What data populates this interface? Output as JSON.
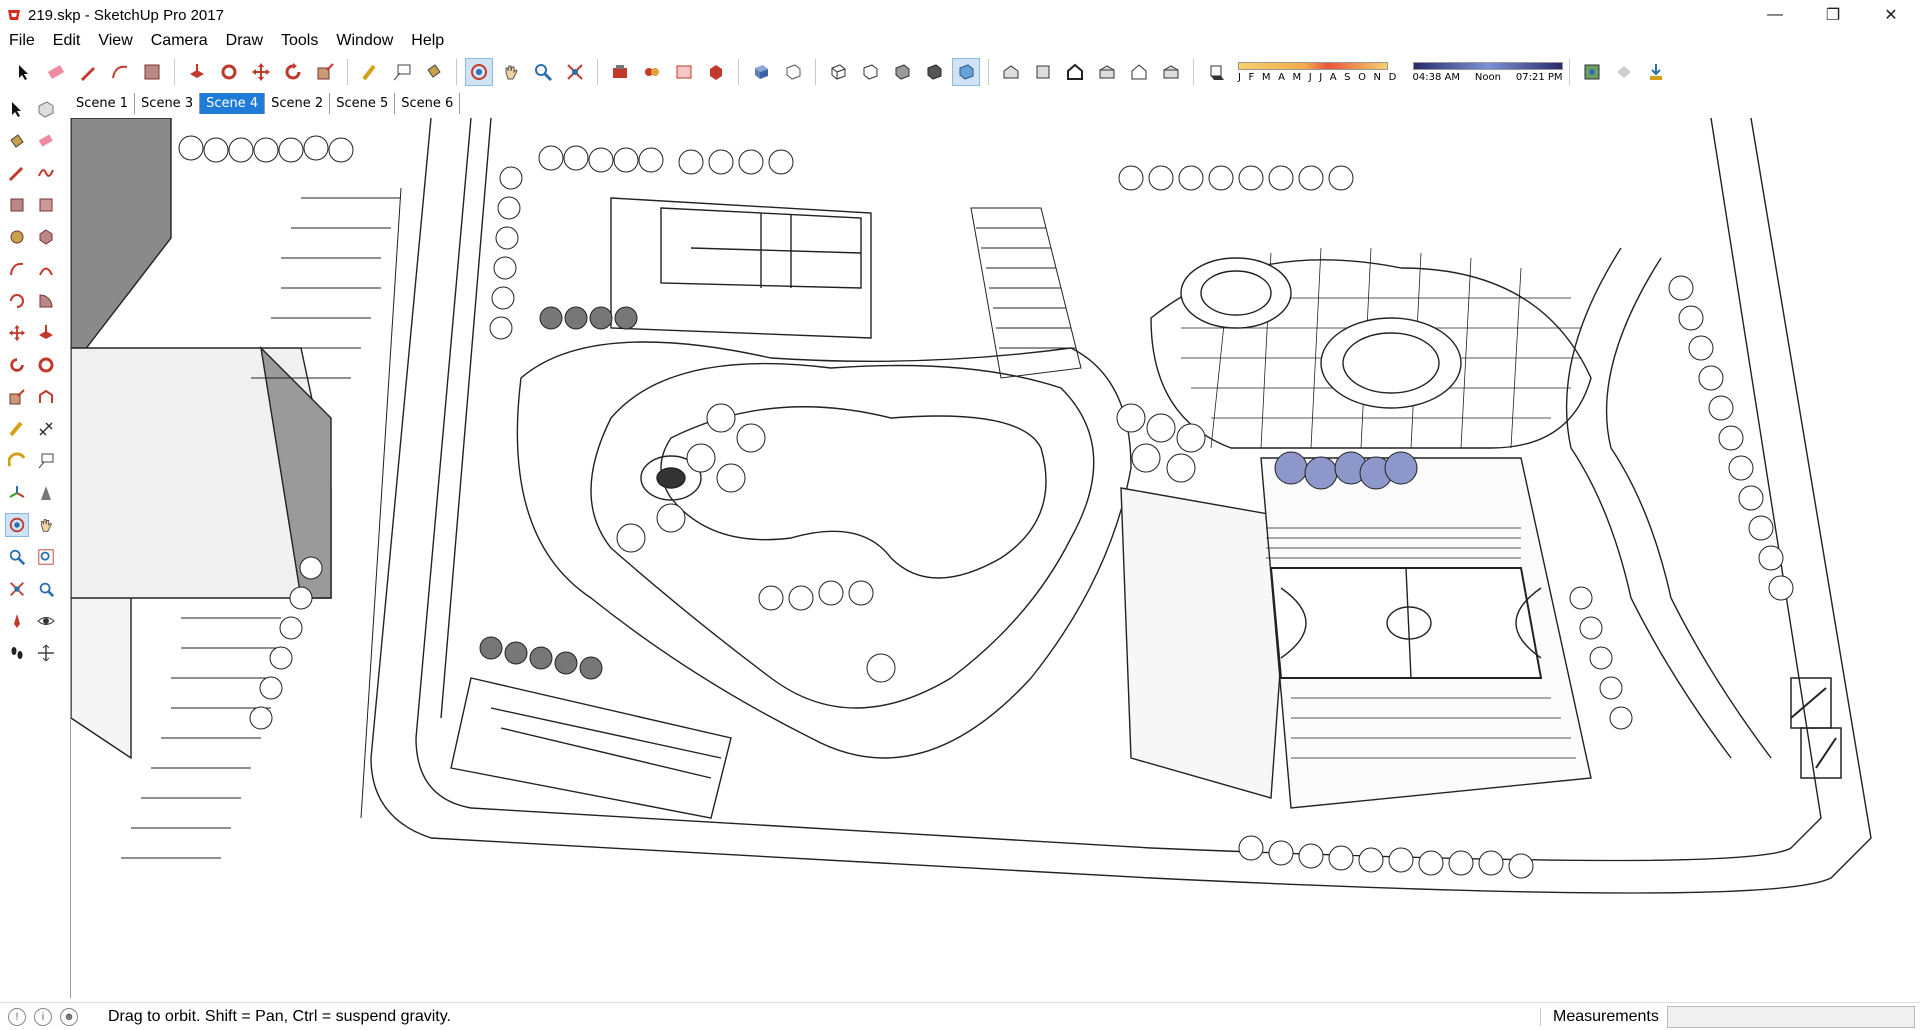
{
  "window": {
    "title": "219.skp - SketchUp Pro 2017",
    "minimize_icon": "minimize-icon",
    "maximize_icon": "restore-icon",
    "close_icon": "close-icon"
  },
  "menu": {
    "items": [
      "File",
      "Edit",
      "View",
      "Camera",
      "Draw",
      "Tools",
      "Window",
      "Help"
    ]
  },
  "toolbar": {
    "tools": [
      "select",
      "eraser",
      "pencil",
      "arc",
      "rectangle",
      "push-pull",
      "follow-me",
      "move",
      "rotate",
      "scale",
      "tape-measure",
      "text",
      "paint-bucket",
      "orbit",
      "pan",
      "zoom",
      "zoom-extents",
      "components",
      "materials",
      "styles",
      "3d-warehouse",
      "xray",
      "back-edges",
      "wireframe",
      "hidden-line",
      "shaded",
      "shaded-textures",
      "monochrome",
      "iso",
      "top",
      "front",
      "right",
      "back",
      "left"
    ],
    "shadow_months": "J F M A M J J A S O N D",
    "shadow_time_start": "04:38 AM",
    "shadow_time_mid": "Noon",
    "shadow_time_end": "07:21 PM"
  },
  "scenes": {
    "tabs": [
      "Scene 1",
      "Scene 3",
      "Scene 4",
      "Scene 2",
      "Scene 5",
      "Scene 6"
    ],
    "active": "Scene 4"
  },
  "status": {
    "hint": "Drag to orbit. Shift = Pan, Ctrl = suspend gravity.",
    "measurements_label": "Measurements",
    "measurements_value": ""
  },
  "colors": {
    "active_tab": "#1e7bd6",
    "highlight_trees": "#8e97c9"
  }
}
